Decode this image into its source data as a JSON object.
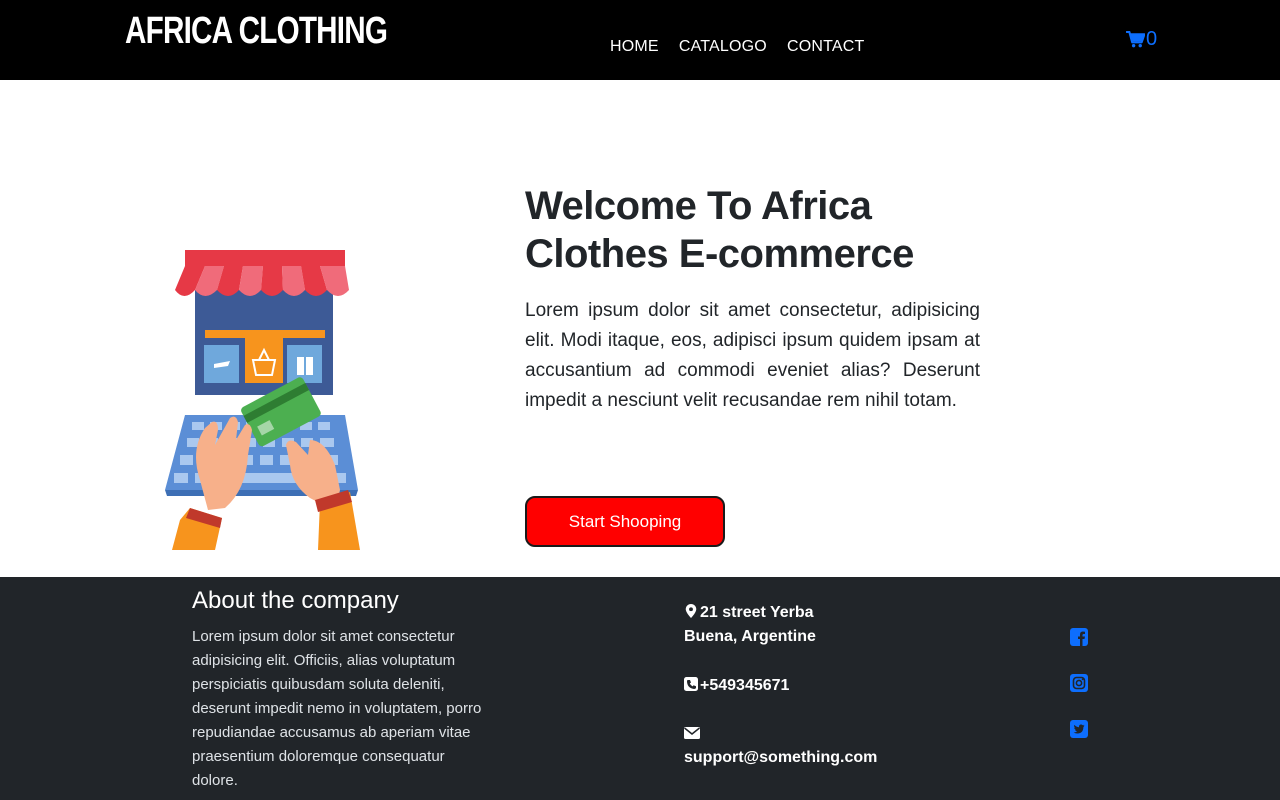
{
  "navbar": {
    "brand": "AFRICA CLOTHING",
    "links": [
      {
        "label": "HOME"
      },
      {
        "label": "CATALOGO"
      },
      {
        "label": "CONTACT"
      }
    ],
    "cart": {
      "icon": "shopping-cart-icon",
      "count": "0"
    }
  },
  "hero": {
    "image_icon": "storefront-shopping-illustration",
    "title": "Welcome To Africa Clothes E-commerce",
    "text": "Lorem ipsum dolor sit amet consectetur, adipisicing elit. Modi itaque, eos, adipisci ipsum quidem ipsam at accusantium ad commodi eveniet alias? Deserunt impedit a nesciunt velit recusandae rem nihil totam.",
    "cta_label": "Start Shooping"
  },
  "footer": {
    "about_title": "About the company",
    "about_text": "Lorem ipsum dolor sit amet consectetur adipisicing elit. Officiis, alias voluptatum perspiciatis quibusdam soluta deleniti, deserunt impedit nemo in voluptatem, porro repudiandae accusamus ab aperiam vitae praesentium doloremque consequatur dolore.",
    "address": "21 street Yerba Buena, Argentine",
    "phone": "+549345671",
    "email": "support@something.com",
    "social": [
      "facebook-icon",
      "instagram-icon",
      "twitter-icon"
    ]
  },
  "colors": {
    "navbar_bg": "#000000",
    "footer_bg": "#212529",
    "accent_blue": "#0d6efd",
    "cta_red": "#ff0000"
  }
}
